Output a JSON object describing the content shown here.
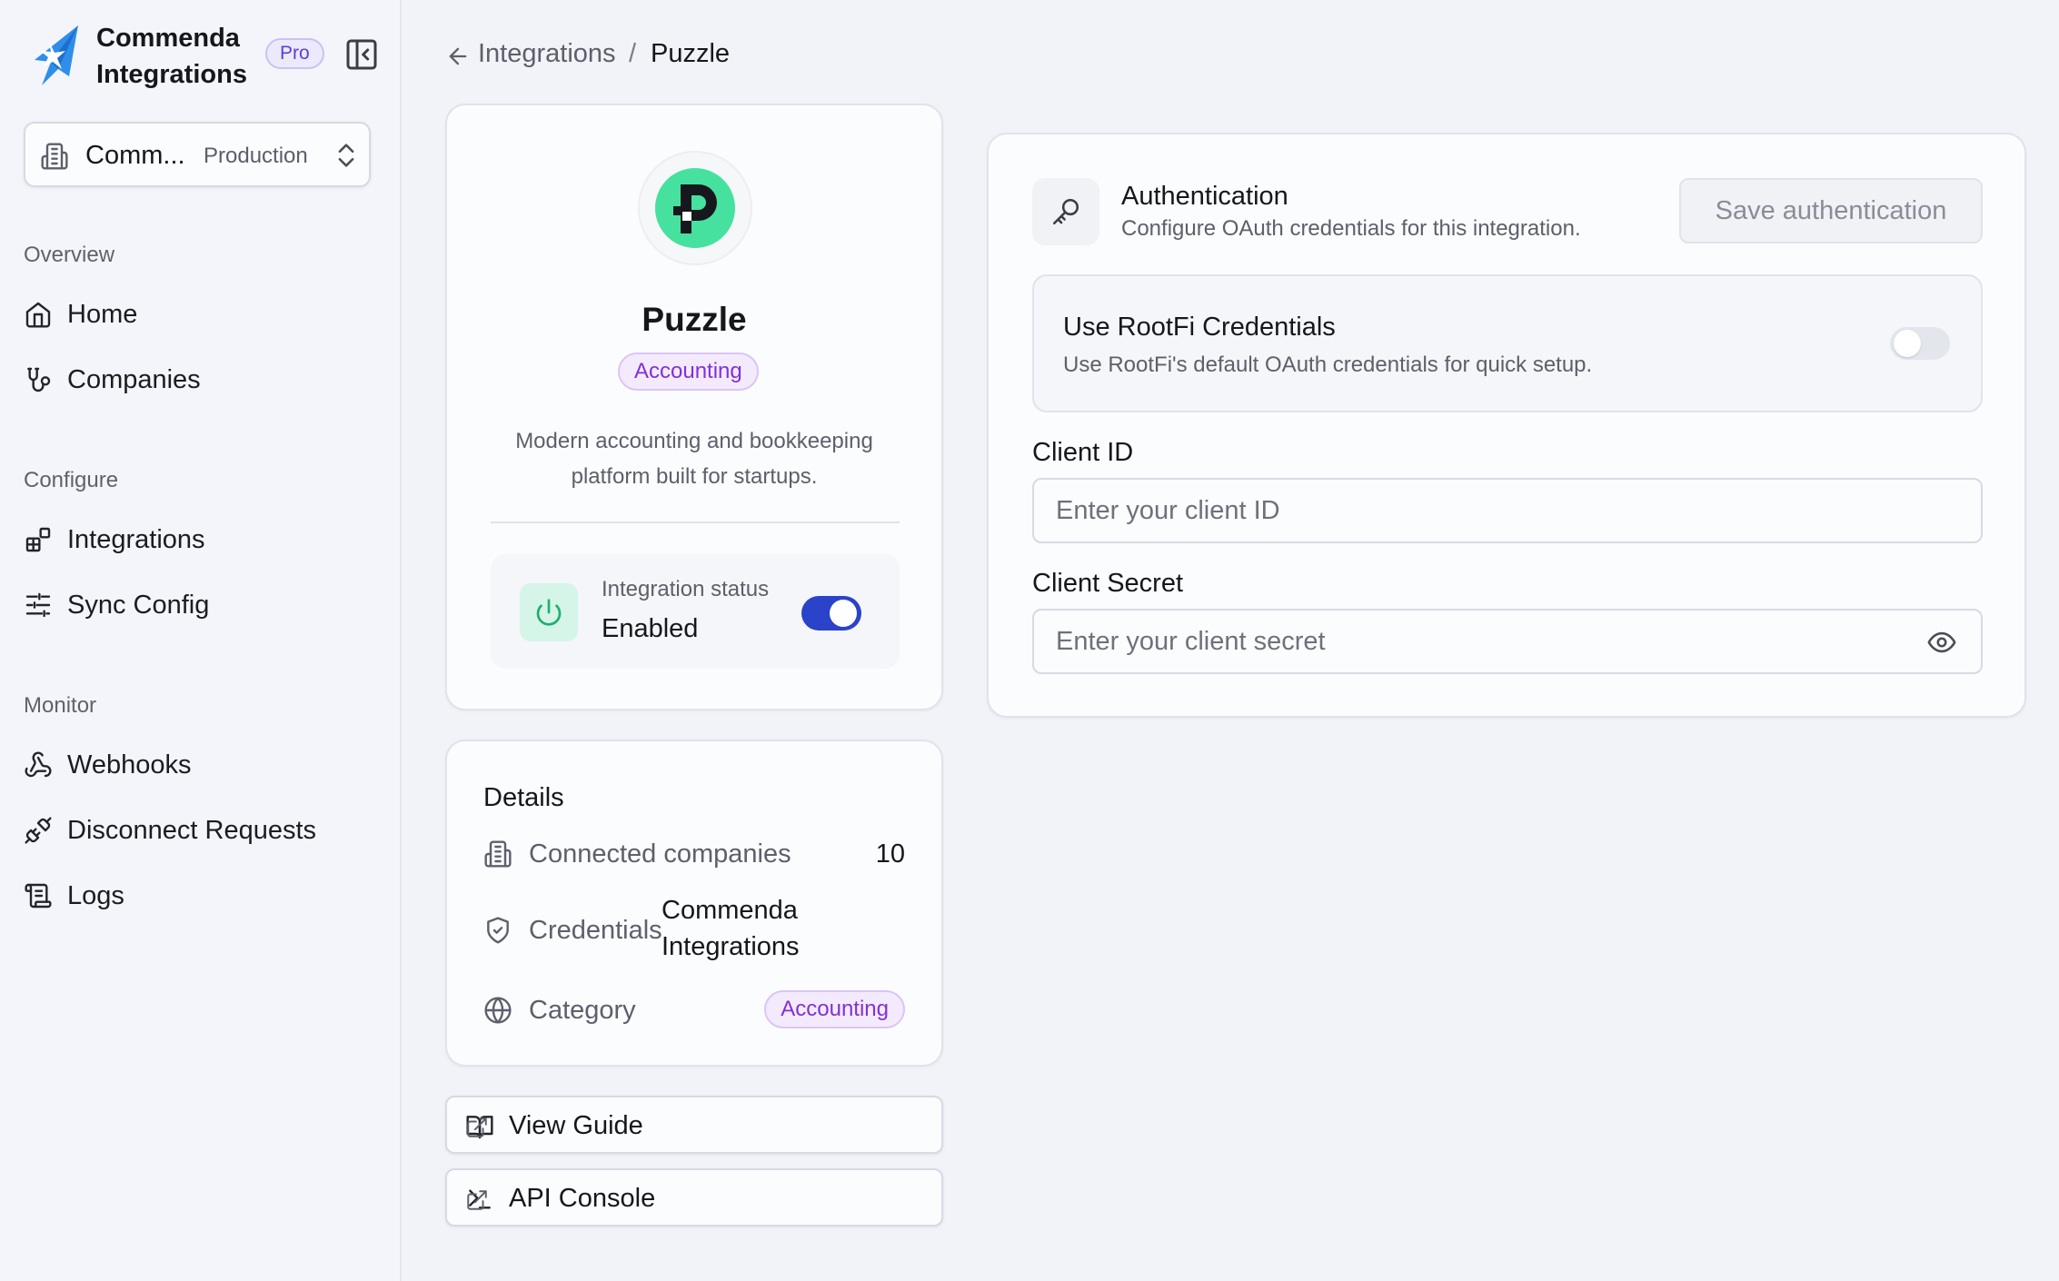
{
  "app": {
    "brand_name": "Commenda Integrations",
    "plan_badge": "Pro",
    "org_name": "Comm...",
    "org_env": "Production"
  },
  "sidebar": {
    "sections": [
      {
        "title": "Overview",
        "items": [
          {
            "label": "Home",
            "icon": "home-icon"
          },
          {
            "label": "Companies",
            "icon": "companies-icon"
          }
        ]
      },
      {
        "title": "Configure",
        "items": [
          {
            "label": "Integrations",
            "icon": "integrations-icon"
          },
          {
            "label": "Sync Config",
            "icon": "sliders-icon"
          }
        ]
      },
      {
        "title": "Monitor",
        "items": [
          {
            "label": "Webhooks",
            "icon": "webhook-icon"
          },
          {
            "label": "Disconnect Requests",
            "icon": "unplug-icon"
          },
          {
            "label": "Logs",
            "icon": "scroll-icon"
          }
        ]
      }
    ]
  },
  "breadcrumb": {
    "parent": "Integrations",
    "separator": "/",
    "current": "Puzzle"
  },
  "integration": {
    "name": "Puzzle",
    "category_tag": "Accounting",
    "description": "Modern accounting and bookkeeping platform built for startups.",
    "status_label": "Integration status",
    "status_value": "Enabled",
    "status_enabled": true
  },
  "details": {
    "title": "Details",
    "rows": [
      {
        "label": "Connected companies",
        "value": "10",
        "icon": "building-icon"
      },
      {
        "label": "Credentials",
        "value": "Commenda Integrations",
        "icon": "shield-check-icon"
      },
      {
        "label": "Category",
        "value": "Accounting",
        "icon": "globe-icon"
      }
    ]
  },
  "links": {
    "guide": "View Guide",
    "console": "API Console"
  },
  "auth": {
    "title": "Authentication",
    "subtitle": "Configure OAuth credentials for this integration.",
    "save_label": "Save authentication",
    "rootfi_title": "Use RootFi Credentials",
    "rootfi_sub": "Use RootFi's default OAuth credentials for quick setup.",
    "rootfi_enabled": false,
    "client_id_label": "Client ID",
    "client_id_placeholder": "Enter your client ID",
    "client_secret_label": "Client Secret",
    "client_secret_placeholder": "Enter your client secret"
  },
  "colors": {
    "accent": "#2a43c8",
    "tag_text": "#8330d8",
    "tag_bg": "#f3ebfd",
    "brand_logo": "#47e19f",
    "status_green": "#1fae6e"
  }
}
